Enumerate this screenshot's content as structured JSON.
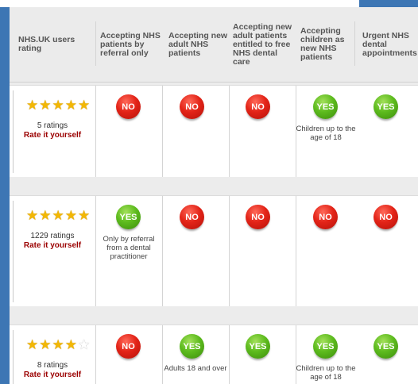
{
  "columns": [
    "NHS.UK users rating",
    "Accepting NHS patients by referral only",
    "Accepting new adult NHS patients",
    "Accepting new adult patients entitled to free NHS dental care",
    "Accepting children as new NHS patients",
    "Urgent NHS dental appointments"
  ],
  "rows": [
    {
      "stars": 5,
      "ratings": "5 ratings",
      "rate_link": "Rate it yourself",
      "referral": "NO",
      "referral_note": "",
      "adult": "NO",
      "adult_note": "",
      "free": "NO",
      "free_note": "",
      "children": "YES",
      "children_note": "Children up to the age of 18",
      "urgent": "YES",
      "urgent_note": ""
    },
    {
      "stars": 5,
      "ratings": "1229 ratings",
      "rate_link": "Rate it yourself",
      "referral": "YES",
      "referral_note": "Only by referral from a dental practitioner",
      "adult": "NO",
      "adult_note": "",
      "free": "NO",
      "free_note": "",
      "children": "NO",
      "children_note": "",
      "urgent": "NO",
      "urgent_note": ""
    },
    {
      "stars": 4,
      "ratings": "8 ratings",
      "rate_link": "Rate it yourself",
      "referral": "NO",
      "referral_note": "",
      "adult": "YES",
      "adult_note": "Adults 18 and over",
      "free": "YES",
      "free_note": "",
      "children": "YES",
      "children_note": "Children up to the age of 18",
      "urgent": "YES",
      "urgent_note": ""
    }
  ],
  "colors": {
    "frame": "#3d76b4",
    "yes": "#5dbb1e",
    "no": "#e32418",
    "rate_link": "#9b0000",
    "star": "#f2b705"
  }
}
